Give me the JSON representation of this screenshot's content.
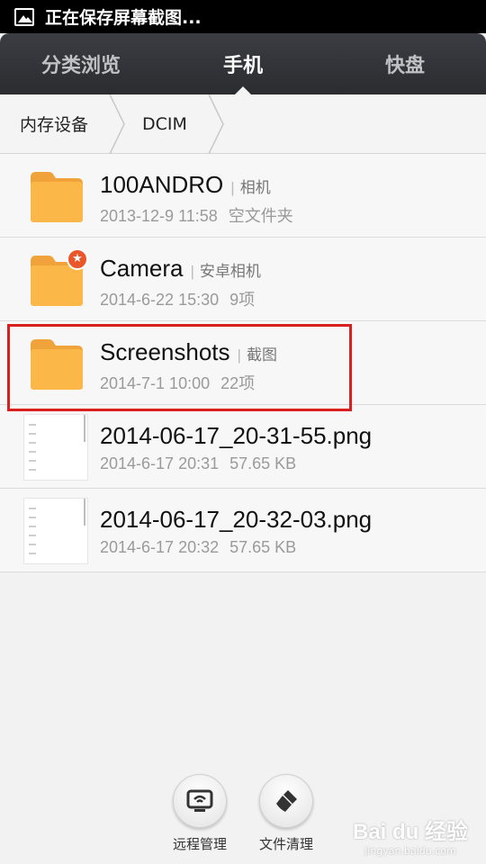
{
  "status_bar": {
    "text": "正在保存屏幕截图..."
  },
  "tabs": [
    {
      "label": "分类浏览",
      "active": false
    },
    {
      "label": "手机",
      "active": true
    },
    {
      "label": "快盘",
      "active": false
    }
  ],
  "breadcrumb": [
    "内存设备",
    "DCIM"
  ],
  "files": [
    {
      "name": "100ANDRO",
      "tag": "相机",
      "date": "2013-12-9 11:58",
      "info": "空文件夹",
      "type": "folder"
    },
    {
      "name": "Camera",
      "tag": "安卓相机",
      "date": "2014-6-22 15:30",
      "info": "9项",
      "type": "folder-starred"
    },
    {
      "name": "Screenshots",
      "tag": "截图",
      "date": "2014-7-1 10:00",
      "info": "22项",
      "type": "folder"
    },
    {
      "name": "2014-06-17_20-31-55.png",
      "date": "2014-6-17 20:31",
      "info": "57.65 KB",
      "type": "image"
    },
    {
      "name": "2014-06-17_20-32-03.png",
      "date": "2014-6-17 20:32",
      "info": "57.65 KB",
      "type": "image"
    }
  ],
  "bottom_tools": [
    {
      "label": "远程管理",
      "icon": "remote-wifi-icon"
    },
    {
      "label": "文件清理",
      "icon": "broom-icon"
    }
  ],
  "watermark": {
    "main": "Bai du 经验",
    "sub": "jingyan.baidu.com"
  },
  "colors": {
    "folder": "#f5a623",
    "highlight": "#d9201f",
    "tab_bg": "#33363b"
  }
}
